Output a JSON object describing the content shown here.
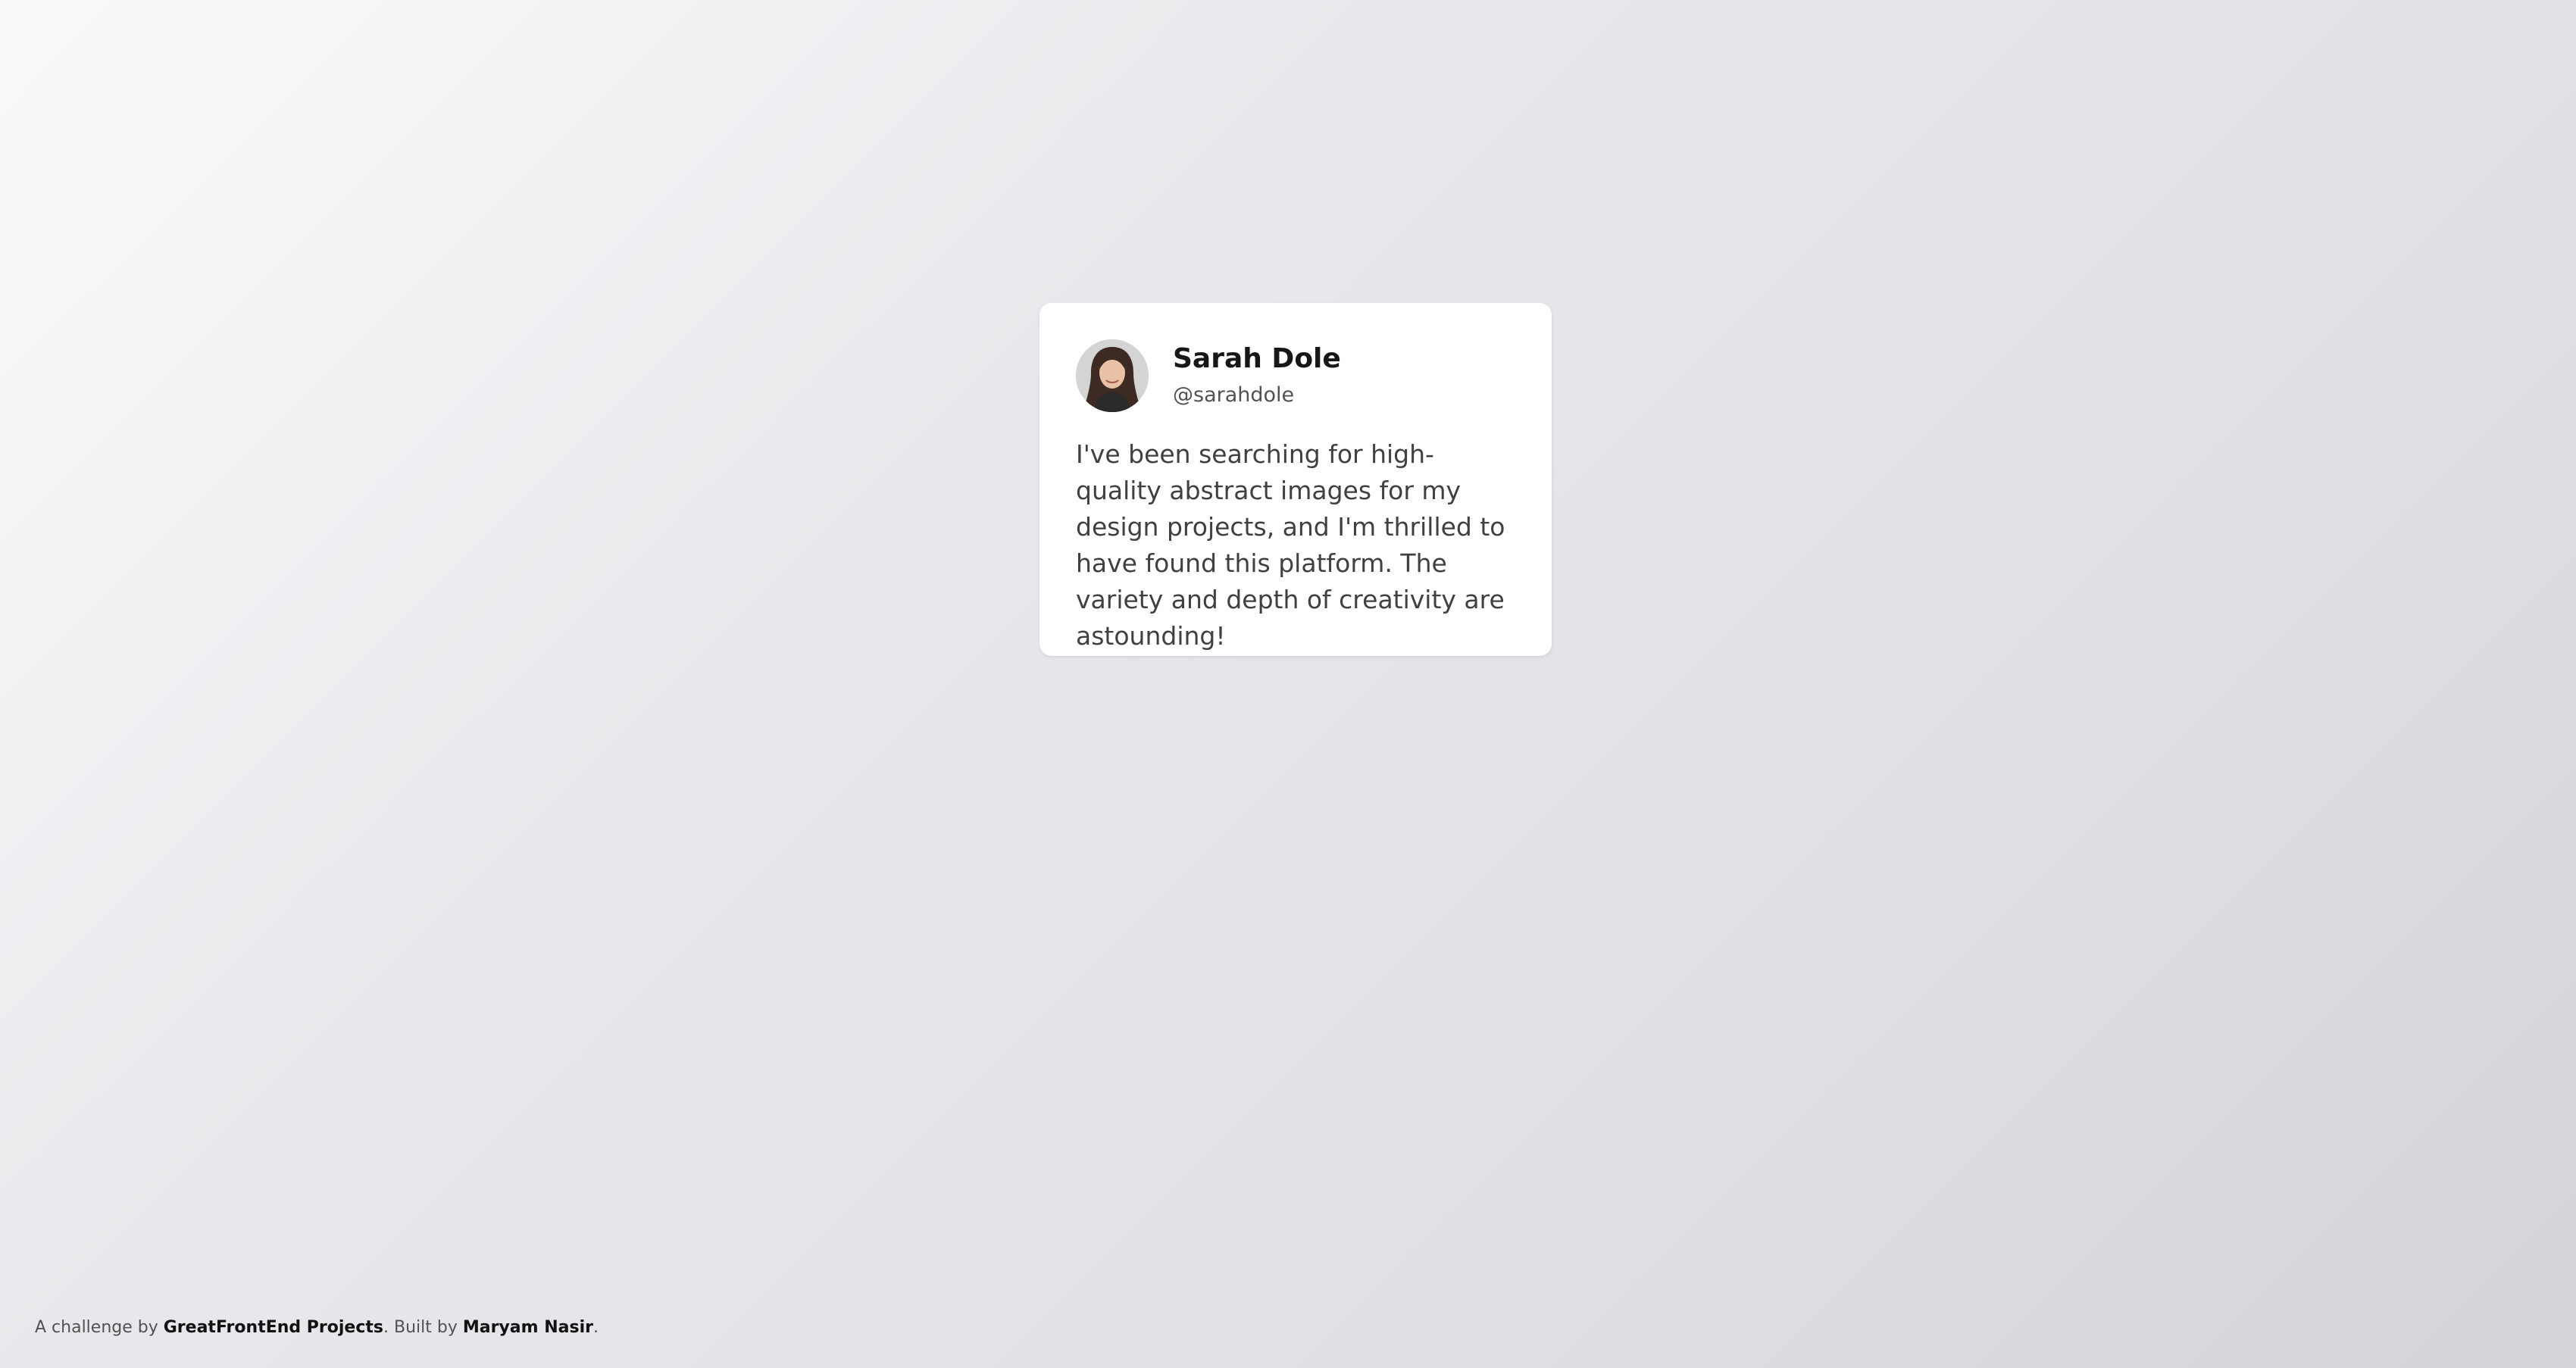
{
  "card": {
    "name": "Sarah Dole",
    "handle": "@sarahdole",
    "quote": "I've been searching for high-quality abstract images for my design projects, and I'm thrilled to have found this platform. The variety and depth of creativity are astounding!",
    "avatar_icon": "user-photo"
  },
  "footer": {
    "prefix": "A challenge by ",
    "challenge_link": "GreatFrontEnd Projects",
    "middle": ". Built by ",
    "author_link": "Maryam Nasir",
    "suffix": "."
  },
  "colors": {
    "card_background": "#ffffff",
    "name_text": "#171717",
    "handle_text": "#525252",
    "quote_text": "#404040"
  }
}
